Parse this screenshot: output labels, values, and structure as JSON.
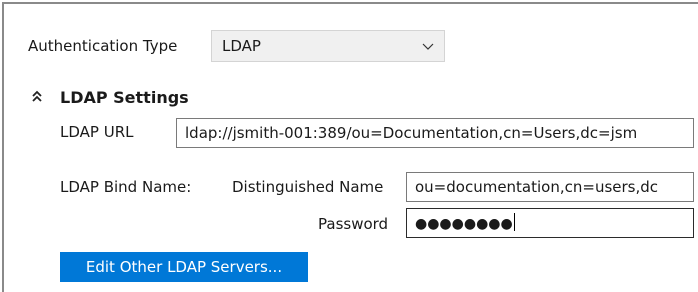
{
  "auth": {
    "label": "Authentication Type",
    "selected": "LDAP"
  },
  "ldap_settings": {
    "title": "LDAP Settings",
    "url_label": "LDAP URL",
    "url_value": "ldap://jsmith-001:389/ou=Documentation,cn=Users,dc=jsm",
    "bind_name_label": "LDAP Bind Name:",
    "dn_label": "Distinguished Name",
    "dn_value": "ou=documentation,cn=users,dc",
    "password_label": "Password",
    "password_value": "●●●●●●●●",
    "edit_servers_button": "Edit Other LDAP Servers..."
  },
  "icons": {
    "dropdown": "chevron-down-icon",
    "section_toggle": "double-chevron-up-icon"
  },
  "colors": {
    "accent": "#0078d7"
  }
}
